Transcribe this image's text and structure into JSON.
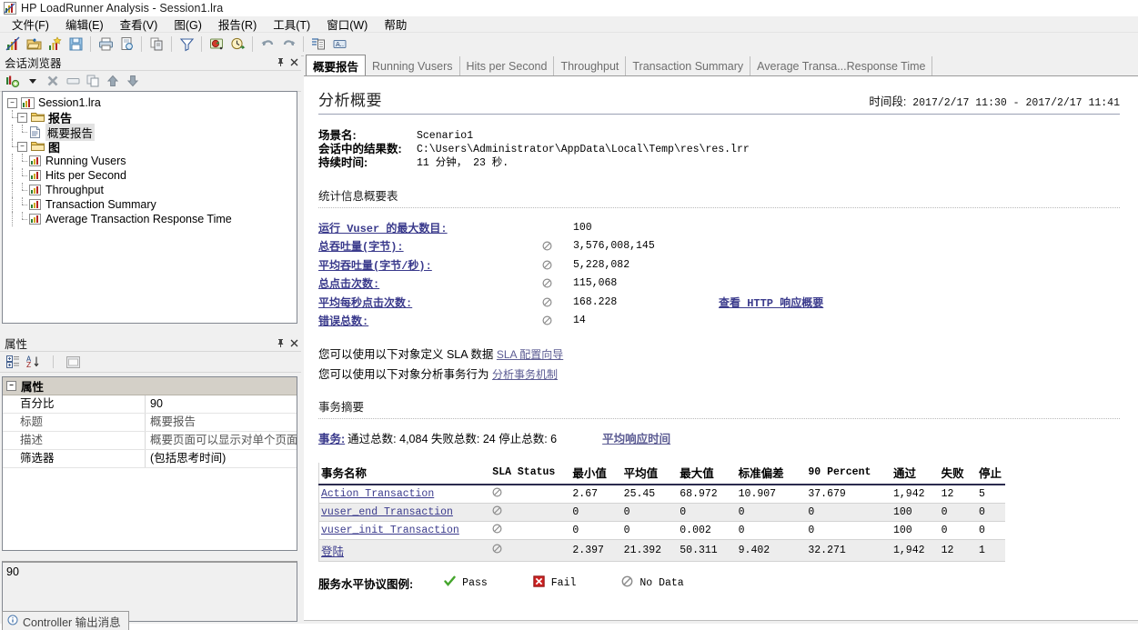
{
  "window": {
    "title": "HP LoadRunner Analysis - Session1.lra",
    "icon": "loadrunner-app-icon"
  },
  "menubar": {
    "items": [
      {
        "label": "文件(F)",
        "name": "menu-file"
      },
      {
        "label": "编辑(E)",
        "name": "menu-edit"
      },
      {
        "label": "查看(V)",
        "name": "menu-view"
      },
      {
        "label": "图(G)",
        "name": "menu-graph"
      },
      {
        "label": "报告(R)",
        "name": "menu-report"
      },
      {
        "label": "工具(T)",
        "name": "menu-tools"
      },
      {
        "label": "窗口(W)",
        "name": "menu-window"
      },
      {
        "label": "帮助",
        "name": "menu-help"
      }
    ]
  },
  "toolbar": {
    "buttons": [
      "new-analysis-icon",
      "open-icon",
      "new-graph-icon",
      "save-icon",
      "print-icon",
      "print-preview-icon",
      "copy-to-clipboard-icon",
      "filter-icon",
      "set-granularity-icon",
      "auto-correlate-icon",
      "undo-icon",
      "redo-icon",
      "configure-icon",
      "about-icon"
    ]
  },
  "session_explorer": {
    "title": "会话浏览器",
    "toolbar": [
      "add-graph-icon",
      "dropdown-arrow-icon",
      "delete-icon",
      "rename-icon",
      "duplicate-icon",
      "move-up-icon",
      "move-down-icon"
    ],
    "tree": {
      "root": "Session1.lra",
      "groups": [
        {
          "label": "报告",
          "items": [
            {
              "label": "概要报告",
              "selected": true
            }
          ]
        },
        {
          "label": "图",
          "items": [
            {
              "label": "Running Vusers",
              "selected": false
            },
            {
              "label": "Hits per Second",
              "selected": false
            },
            {
              "label": "Throughput",
              "selected": false
            },
            {
              "label": "Transaction Summary",
              "selected": false
            },
            {
              "label": "Average Transaction Response Time",
              "selected": false
            }
          ]
        }
      ]
    }
  },
  "properties_panel": {
    "title": "属性",
    "toolbar": [
      "categorized-icon",
      "alphabetical-icon",
      "property-pages-icon"
    ],
    "group_header": "属性",
    "rows": [
      {
        "key": "百分比",
        "value": "90",
        "selected": true
      },
      {
        "key": "标题",
        "value": "概要报告",
        "selected": false
      },
      {
        "key": "描述",
        "value": "概要页面可以显示对单个页面的",
        "selected": false
      },
      {
        "key": "筛选器",
        "value": "(包括思考时间)",
        "selected": false
      }
    ],
    "description_value": "90"
  },
  "status_bar": {
    "tab_label": "Controller 输出消息",
    "tab_icon": "info-icon"
  },
  "tabs": [
    {
      "label": "概要报告",
      "active": true
    },
    {
      "label": "Running Vusers",
      "active": false
    },
    {
      "label": "Hits per Second",
      "active": false
    },
    {
      "label": "Throughput",
      "active": false
    },
    {
      "label": "Transaction Summary",
      "active": false
    },
    {
      "label": "Average Transa...Response Time",
      "active": false
    }
  ],
  "report": {
    "title": "分析概要",
    "period_label": "时间段:",
    "period_value": "2017/2/17 11:30 - 2017/2/17 11:41",
    "meta": [
      {
        "key": "场景名:",
        "value": "Scenario1"
      },
      {
        "key": "会话中的结果数:",
        "value": "C:\\Users\\Administrator\\AppData\\Local\\Temp\\res\\res.lrr"
      },
      {
        "key": "持续时间:",
        "value": "11 分钟， 23 秒."
      }
    ],
    "stats_section_title": "统计信息概要表",
    "stats": [
      {
        "label": "运行 Vuser 的最大数目:",
        "icon": false,
        "value": "100",
        "extra": ""
      },
      {
        "label": "总吞吐量(字节):",
        "icon": true,
        "value": "3,576,008,145",
        "extra": ""
      },
      {
        "label": "平均吞吐量(字节/秒):",
        "icon": true,
        "value": "5,228,082",
        "extra": ""
      },
      {
        "label": "总点击次数:",
        "icon": true,
        "value": "115,068",
        "extra": ""
      },
      {
        "label": "平均每秒点击次数:",
        "icon": true,
        "value": "168.228",
        "extra": "查看 HTTP 响应概要"
      },
      {
        "label": "错误总数:",
        "icon": true,
        "value": "14",
        "extra": ""
      }
    ],
    "sla_line_1_text": "您可以使用以下对象定义 SLA 数据",
    "sla_line_1_link": "SLA 配置向导",
    "sla_line_2_text": "您可以使用以下对象分析事务行为",
    "sla_line_2_link": "分析事务机制",
    "tx_section_title": "事务摘要",
    "tx_summary_link": "事务:",
    "tx_summary_counts": "通过总数: 4,084 失败总数: 24 停止总数: 6",
    "tx_summary_avg_link": "平均响应时间",
    "table": {
      "headers": [
        "事务名称",
        "SLA Status",
        "最小值",
        "平均值",
        "最大值",
        "标准偏差",
        "90 Percent",
        "通过",
        "失败",
        "停止"
      ],
      "rows": [
        {
          "name": "Action Transaction",
          "sla": "no-data",
          "min": "2.67",
          "avg": "25.45",
          "max": "68.972",
          "sd": "10.907",
          "p90": "37.679",
          "pass": "1,942",
          "fail": "12",
          "stop": "5"
        },
        {
          "name": "vuser_end Transaction",
          "sla": "no-data",
          "min": "0",
          "avg": "0",
          "max": "0",
          "sd": "0",
          "p90": "0",
          "pass": "100",
          "fail": "0",
          "stop": "0"
        },
        {
          "name": "vuser_init Transaction",
          "sla": "no-data",
          "min": "0",
          "avg": "0",
          "max": "0.002",
          "sd": "0",
          "p90": "0",
          "pass": "100",
          "fail": "0",
          "stop": "0"
        },
        {
          "name": "登陆",
          "sla": "no-data",
          "min": "2.397",
          "avg": "21.392",
          "max": "50.311",
          "sd": "9.402",
          "p90": "32.271",
          "pass": "1,942",
          "fail": "12",
          "stop": "1"
        }
      ]
    },
    "legend_title": "服务水平协议图例:",
    "legend_items": [
      {
        "icon": "pass-check-icon",
        "label": "Pass"
      },
      {
        "icon": "fail-cross-icon",
        "label": "Fail"
      },
      {
        "icon": "no-data-icon",
        "label": "No Data"
      }
    ]
  },
  "colors": {
    "link": "#3a3a8c",
    "link_soft": "#5c5c93",
    "pass_green": "#3fa22a",
    "fail_red": "#cc2222",
    "header_rule": "#2b2b4e"
  }
}
